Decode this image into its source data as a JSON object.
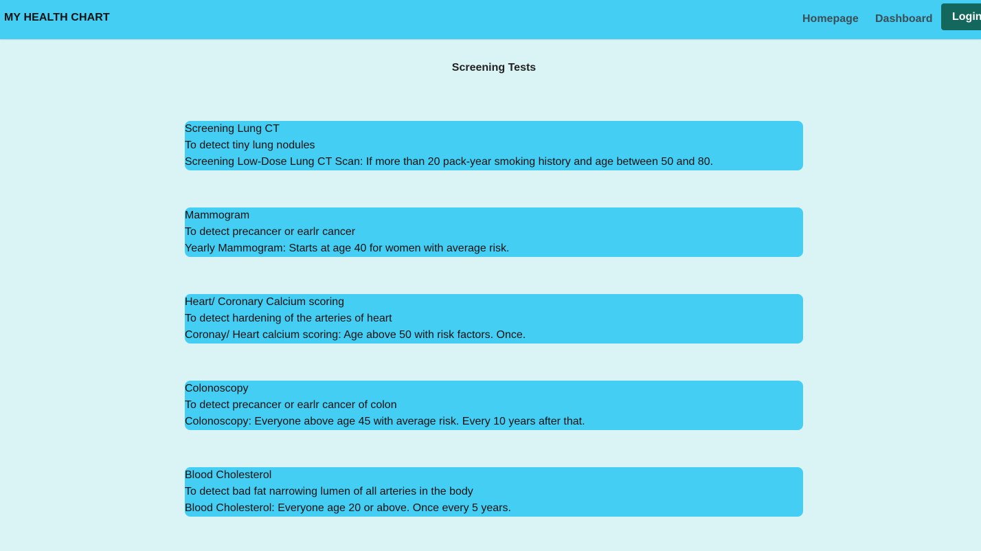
{
  "header": {
    "brand": "MY HEALTH CHART",
    "nav": {
      "homepage": "Homepage",
      "dashboard": "Dashboard",
      "login": "Login"
    }
  },
  "main": {
    "title": "Screening Tests",
    "tests": [
      {
        "name": "Screening Lung CT",
        "purpose": "To detect tiny lung nodules",
        "recommendation": "Screening Low-Dose Lung CT Scan: If more than 20 pack-year smoking history and age between 50 and 80."
      },
      {
        "name": "Mammogram",
        "purpose": "To detect precancer or earlr cancer",
        "recommendation": "Yearly Mammogram: Starts at age 40 for women with average risk."
      },
      {
        "name": "Heart/ Coronary Calcium scoring",
        "purpose": "To detect hardening of the arteries of heart",
        "recommendation": "Coronay/ Heart calcium scoring: Age above 50 with risk factors. Once."
      },
      {
        "name": "Colonoscopy",
        "purpose": "To detect precancer or earlr cancer of colon",
        "recommendation": "Colonoscopy: Everyone above age 45 with average risk. Every 10 years after that."
      },
      {
        "name": "Blood Cholesterol",
        "purpose": "To detect bad fat narrowing lumen of all arteries in the body",
        "recommendation": "Blood Cholesterol: Everyone age 20 or above. Once every 5 years."
      }
    ]
  },
  "colors": {
    "navbar": "#45cef3",
    "background": "#daf4f5",
    "card": "#45cef3",
    "login_button": "#14675c"
  }
}
